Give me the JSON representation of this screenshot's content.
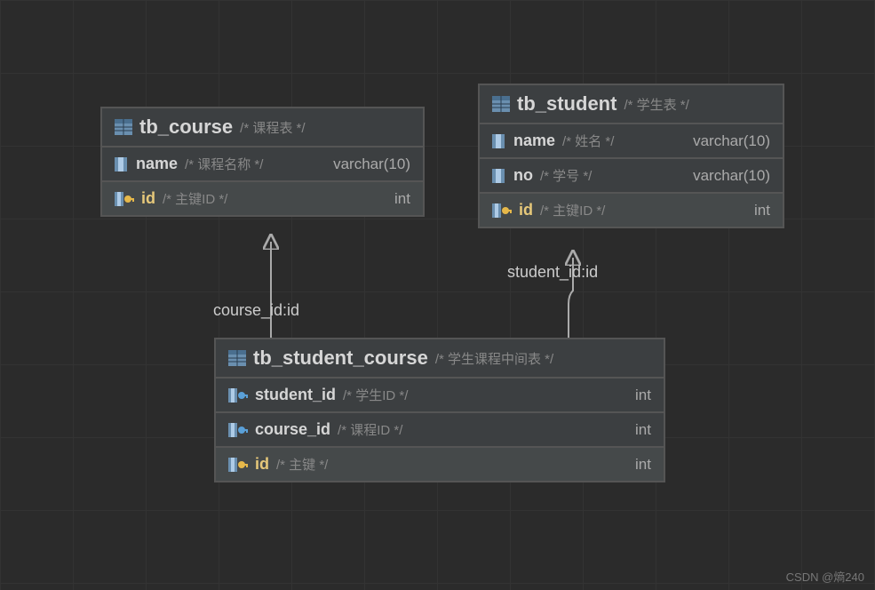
{
  "entities": {
    "course": {
      "title": "tb_course",
      "comment": "/* 课程表 */",
      "rows": [
        {
          "name": "name",
          "comment": "/* 课程名称 */",
          "type": "varchar(10)",
          "key": false,
          "fk": false
        },
        {
          "name": "id",
          "comment": "/* 主键ID */",
          "type": "int",
          "key": true,
          "fk": false
        }
      ]
    },
    "student": {
      "title": "tb_student",
      "comment": "/* 学生表 */",
      "rows": [
        {
          "name": "name",
          "comment": "/* 姓名 */",
          "type": "varchar(10)",
          "key": false,
          "fk": false
        },
        {
          "name": "no",
          "comment": "/* 学号 */",
          "type": "varchar(10)",
          "key": false,
          "fk": false
        },
        {
          "name": "id",
          "comment": "/* 主键ID */",
          "type": "int",
          "key": true,
          "fk": false
        }
      ]
    },
    "student_course": {
      "title": "tb_student_course",
      "comment": "/* 学生课程中间表 */",
      "rows": [
        {
          "name": "student_id",
          "comment": "/* 学生ID */",
          "type": "int",
          "key": false,
          "fk": true
        },
        {
          "name": "course_id",
          "comment": "/* 课程ID */",
          "type": "int",
          "key": false,
          "fk": true
        },
        {
          "name": "id",
          "comment": "/* 主键 */",
          "type": "int",
          "key": true,
          "fk": false
        }
      ]
    }
  },
  "relations": {
    "course_rel": "course_id:id",
    "student_rel": "student_id:id"
  },
  "watermark": "CSDN @熵240"
}
